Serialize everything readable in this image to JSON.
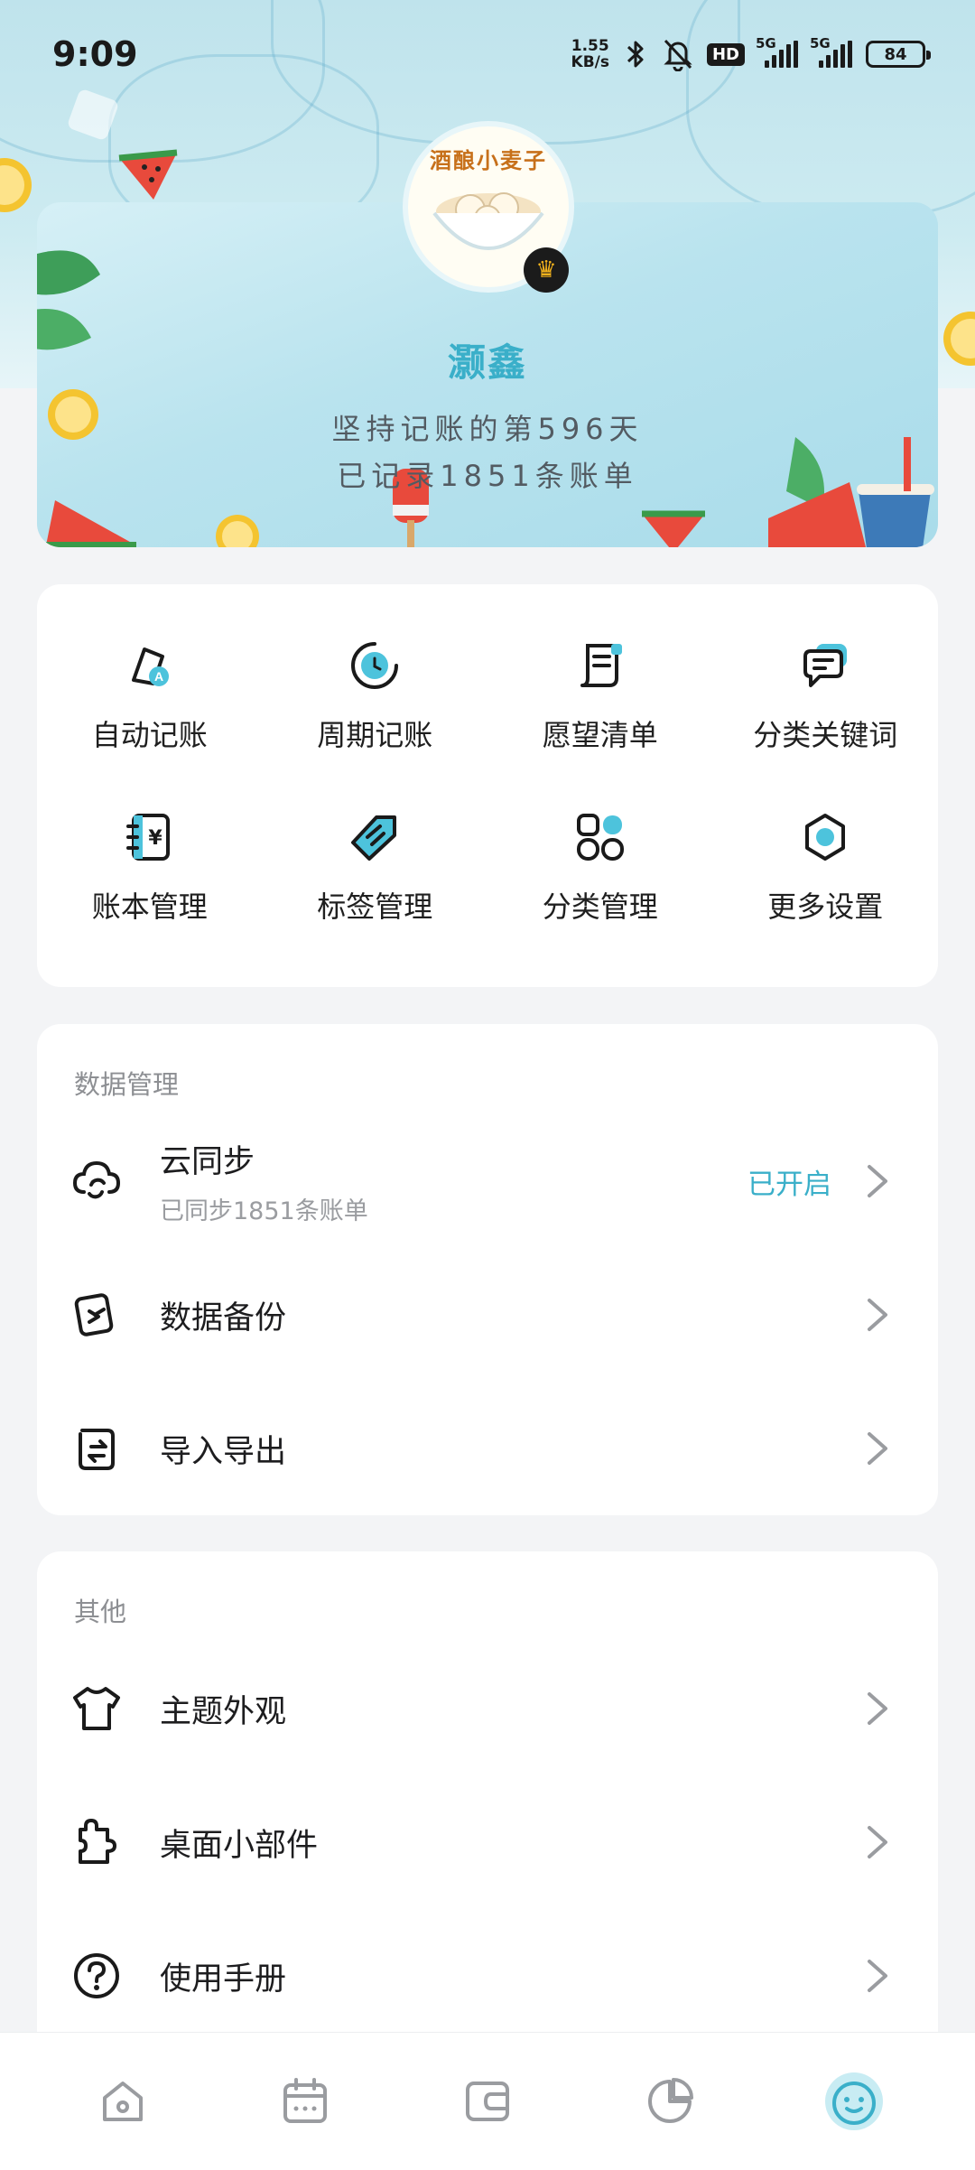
{
  "status_bar": {
    "time": "9:09",
    "net_speed_value": "1.55",
    "net_speed_unit": "KB/s",
    "hd_label": "HD",
    "sim1": "5G",
    "sim2": "5G",
    "battery": "84"
  },
  "profile": {
    "avatar_text": "酒酿小麦子",
    "username": "灏鑫",
    "days_line": "坚持记账的第596天",
    "records_line": "已记录1851条账单"
  },
  "features": [
    {
      "label": "自动记账",
      "icon": "auto-record-icon"
    },
    {
      "label": "周期记账",
      "icon": "periodic-record-icon"
    },
    {
      "label": "愿望清单",
      "icon": "wishlist-icon"
    },
    {
      "label": "分类关键词",
      "icon": "category-keyword-icon"
    },
    {
      "label": "账本管理",
      "icon": "ledger-icon"
    },
    {
      "label": "标签管理",
      "icon": "tag-icon"
    },
    {
      "label": "分类管理",
      "icon": "category-icon"
    },
    {
      "label": "更多设置",
      "icon": "settings-icon"
    }
  ],
  "data_section": {
    "title": "数据管理",
    "items": [
      {
        "title": "云同步",
        "subtitle": "已同步1851条账单",
        "status": "已开启",
        "icon": "cloud-sync-icon"
      },
      {
        "title": "数据备份",
        "icon": "backup-icon"
      },
      {
        "title": "导入导出",
        "icon": "import-export-icon"
      }
    ]
  },
  "other_section": {
    "title": "其他",
    "items": [
      {
        "title": "主题外观",
        "icon": "tshirt-icon"
      },
      {
        "title": "桌面小部件",
        "icon": "widget-icon"
      },
      {
        "title": "使用手册",
        "icon": "help-icon"
      }
    ]
  },
  "bottom_nav": [
    {
      "icon": "home-icon",
      "active": false
    },
    {
      "icon": "calendar-icon",
      "active": false
    },
    {
      "icon": "wallet-icon",
      "active": false
    },
    {
      "icon": "pie-chart-icon",
      "active": false
    },
    {
      "icon": "profile-face-icon",
      "active": true
    }
  ],
  "colors": {
    "accent": "#3aafc9",
    "page_bg": "#f3f4f6"
  }
}
